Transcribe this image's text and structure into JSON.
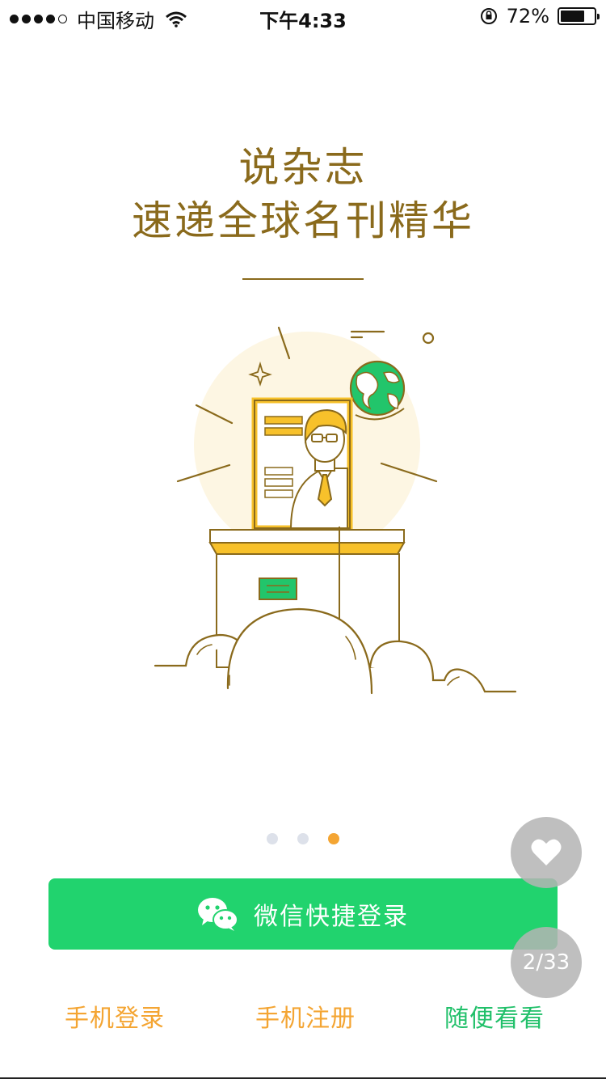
{
  "status_bar": {
    "carrier": "中国移动",
    "time": "下午4:33",
    "battery_percent": "72%",
    "battery_level": 0.72,
    "icons": [
      "signal-dots-icon",
      "wifi-icon",
      "orientation-lock-icon",
      "battery-icon"
    ]
  },
  "headline": {
    "line1": "说杂志",
    "line2": "速递全球名刊精华"
  },
  "pager": {
    "count": 3,
    "active_index": 2
  },
  "wechat_login": {
    "label": "微信快捷登录",
    "icon": "wechat-icon",
    "color": "#21d36e"
  },
  "fab": {
    "heart_icon": "heart-icon",
    "page_counter": "2/33"
  },
  "links": {
    "phone_login": "手机登录",
    "phone_register": "手机注册",
    "browse": "随便看看"
  },
  "colors": {
    "accent_orange": "#f4a533",
    "accent_green": "#21d36e",
    "headline_brown": "#8a6a1c"
  }
}
